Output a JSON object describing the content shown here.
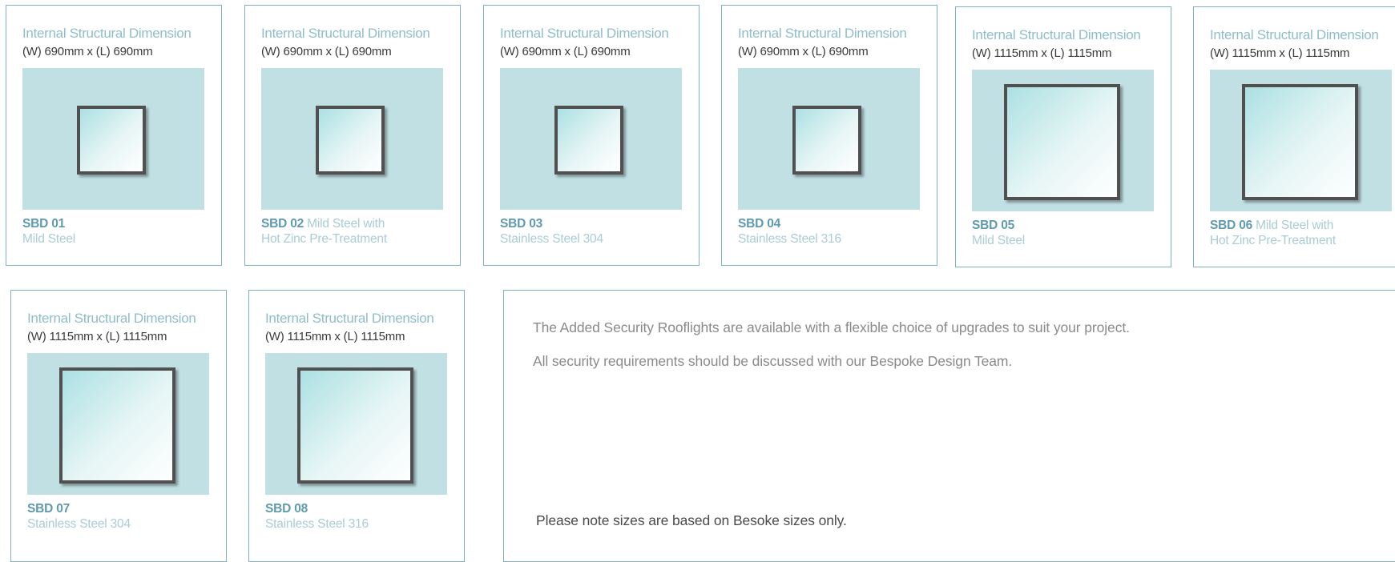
{
  "products": [
    {
      "title": "Internal Structural Dimension",
      "dims": "(W) 690mm x (L) 690mm",
      "code": "SBD 01",
      "material": " ",
      "material2": "Mild Steel"
    },
    {
      "title": "Internal Structural Dimension",
      "dims": "(W) 690mm x (L) 690mm",
      "code": "SBD 02",
      "material": " Mild Steel with",
      "material2": "Hot Zinc Pre-Treatment"
    },
    {
      "title": "Internal Structural Dimension",
      "dims": "(W) 690mm x (L) 690mm",
      "code": "SBD 03",
      "material": " ",
      "material2": "Stainless Steel 304"
    },
    {
      "title": "Internal Structural Dimension",
      "dims": "(W) 690mm x (L) 690mm",
      "code": "SBD 04",
      "material": " ",
      "material2": "Stainless Steel 316"
    },
    {
      "title": "Internal Structural Dimension",
      "dims": "(W) 1115mm x (L) 1115mm",
      "code": "SBD 05",
      "material": " ",
      "material2": "Mild Steel"
    },
    {
      "title": "Internal Structural Dimension",
      "dims": "(W) 1115mm x (L) 1115mm",
      "code": "SBD 06",
      "material": " Mild Steel with",
      "material2": "Hot Zinc Pre-Treatment"
    },
    {
      "title": "Internal Structural Dimension",
      "dims": "(W) 1115mm x (L) 1115mm",
      "code": "SBD 07",
      "material": " ",
      "material2": "Stainless Steel 304"
    },
    {
      "title": "Internal Structural Dimension",
      "dims": "(W) 1115mm x (L) 1115mm",
      "code": "SBD 08",
      "material": " ",
      "material2": "Stainless Steel 316"
    }
  ],
  "info": {
    "line1": "The Added Security Rooflights are available with a flexible choice of upgrades to suit your project.",
    "line2": "All security requirements should be discussed with our Bespoke Design Team.",
    "note": "Please note sizes are based on Besoke sizes only."
  }
}
